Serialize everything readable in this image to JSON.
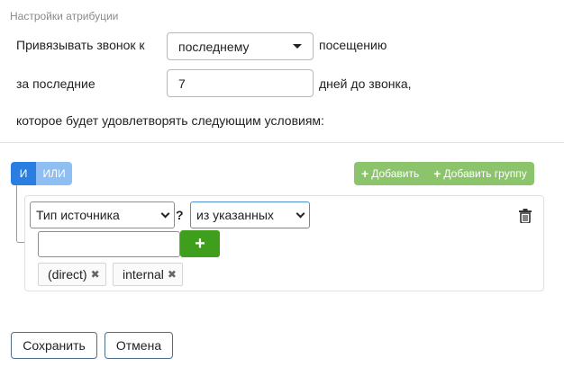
{
  "section_title": "Настройки атрибуции",
  "row1": {
    "label": "Привязывать звонок к",
    "select_value": "последнему",
    "suffix": "посещению"
  },
  "row2": {
    "label": "за последние",
    "input_value": "7",
    "suffix": "дней до звонка,"
  },
  "row3": {
    "text": "которое будет удовлетворять следующим условиям:"
  },
  "logic": {
    "and_label": "И",
    "or_label": "ИЛИ"
  },
  "actions": {
    "add_label": "Добавить",
    "add_group_label": "Добавить группу"
  },
  "rule": {
    "field": "Тип источника",
    "question": "?",
    "operator": "из указанных",
    "add_value_symbol": "+",
    "values": [
      "(direct)",
      "internal"
    ],
    "remove_symbol": "✖"
  },
  "footer": {
    "save_label": "Сохранить",
    "cancel_label": "Отмена"
  },
  "colors": {
    "primary": "#2a7de1",
    "primary_light": "#8fbff2",
    "success": "#8cc46b",
    "success_dark": "#3f9e1c"
  },
  "icons": {
    "delete": "trash-icon",
    "add": "plus-icon",
    "remove_tag": "close-icon"
  }
}
